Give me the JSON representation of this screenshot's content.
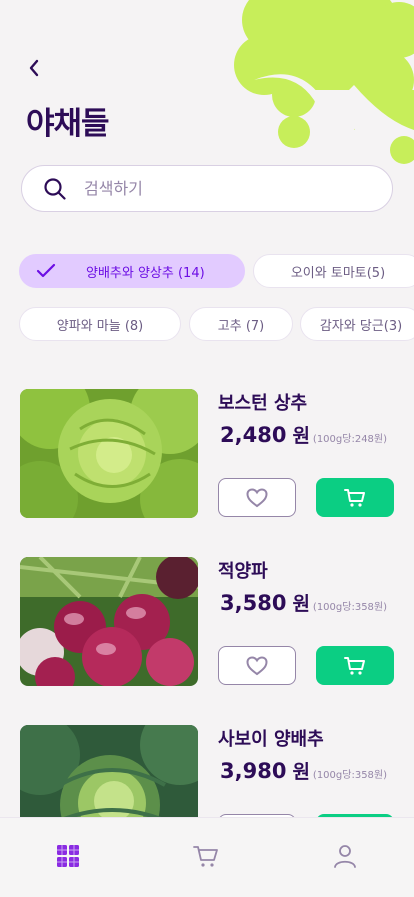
{
  "page": {
    "title": "야채들"
  },
  "search": {
    "placeholder": "검색하기",
    "value": ""
  },
  "filters": [
    {
      "label": "양배추와 양상추 (14)",
      "selected": true
    },
    {
      "label": "오이와 토마토(5)",
      "selected": false
    },
    {
      "label": "양파와 마늘 (8)",
      "selected": false
    },
    {
      "label": "고추 (7)",
      "selected": false
    },
    {
      "label": "감자와 당근(3)",
      "selected": false
    }
  ],
  "products": [
    {
      "name": "보스턴 상추",
      "price": "2,480",
      "currency": "원",
      "unit_price": "(100g당:248원)"
    },
    {
      "name": "적양파",
      "price": "3,580",
      "currency": "원",
      "unit_price": "(100g당:358원)"
    },
    {
      "name": "사보이 양배추",
      "price": "3,980",
      "currency": "원",
      "unit_price": "(100g당:358원)"
    }
  ],
  "nav": {
    "active": "grid"
  },
  "colors": {
    "accent": "#6c0ee4",
    "cart_button": "#0bce83",
    "chip_active_bg": "#e2cbff",
    "title": "#2d0c57",
    "muted": "#9586a8",
    "deco": "#c7ee5a"
  },
  "icons": [
    "back-icon",
    "search-icon",
    "check-icon",
    "heart-icon",
    "cart-icon",
    "grid-icon",
    "user-icon"
  ]
}
